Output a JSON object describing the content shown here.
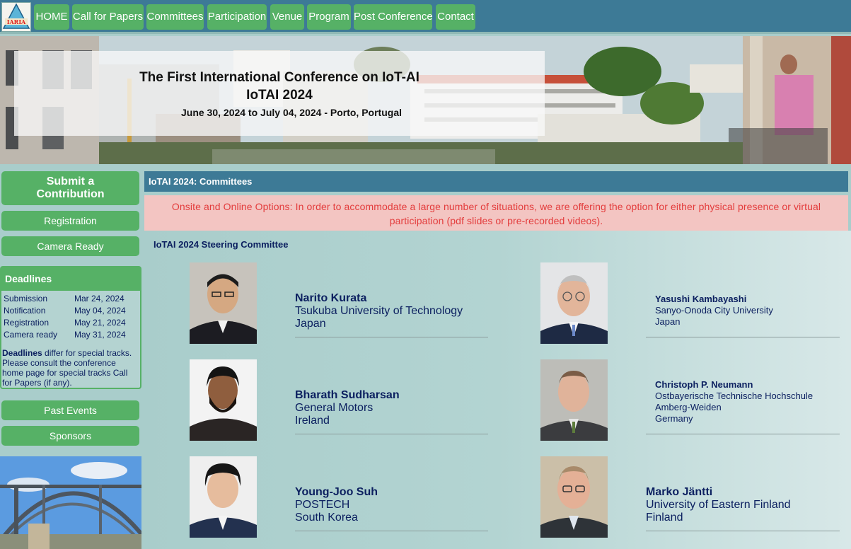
{
  "nav": {
    "logo_text": "IARIA",
    "items": [
      {
        "label": "HOME"
      },
      {
        "label": "Call for Papers"
      },
      {
        "label": "Committees"
      },
      {
        "label": "Participation"
      },
      {
        "label": "Venue"
      },
      {
        "label": "Program"
      },
      {
        "label": "Post Conference"
      },
      {
        "label": "Contact"
      }
    ]
  },
  "banner": {
    "title": "The First International Conference on IoT-AI",
    "subtitle": "IoTAI 2024",
    "dates": "June 30, 2024 to July 04, 2024 - Porto, Portugal"
  },
  "sidebar": {
    "submit_line1": "Submit a",
    "submit_line2": "Contribution",
    "registration": "Registration",
    "camera_ready": "Camera Ready",
    "deadlines": {
      "title": "Deadlines",
      "rows": [
        {
          "label": "Submission",
          "date": "Mar 24, 2024"
        },
        {
          "label": "Notification",
          "date": "May 04, 2024"
        },
        {
          "label": "Registration",
          "date": "May 21, 2024"
        },
        {
          "label": "Camera ready",
          "date": "May 31, 2024"
        }
      ],
      "note_bold": "Deadlines",
      "note_rest": " differ for special tracks. Please consult the conference home page for special tracks Call for Papers (if any)."
    },
    "past_events": "Past Events",
    "sponsors": "Sponsors"
  },
  "main": {
    "header": "IoTAI 2024: Committees",
    "notice": "Onsite and Online Options: In order to accommodate a large number of situations, we are offering the option for either physical presence or virtual participation (pdf slides or pre-recorded videos).",
    "section_title": "IoTAI 2024 Steering Committee",
    "members": [
      {
        "name": "Narito Kurata",
        "lines": [
          "Tsukuba University of Technology",
          "Japan"
        ]
      },
      {
        "name": "Yasushi Kambayashi",
        "lines": [
          "Sanyo-Onoda City University",
          "Japan"
        ]
      },
      {
        "name": "Bharath Sudharsan",
        "lines": [
          "General Motors",
          "Ireland"
        ]
      },
      {
        "name": "Christoph P. Neumann",
        "lines": [
          "Ostbayerische Technische Hochschule",
          "Amberg-Weiden",
          "Germany"
        ]
      },
      {
        "name": "Young-Joo Suh",
        "lines": [
          "POSTECH",
          "South Korea"
        ]
      },
      {
        "name": "Marko Jäntti",
        "lines": [
          "University of Eastern Finland",
          "Finland"
        ]
      }
    ]
  }
}
